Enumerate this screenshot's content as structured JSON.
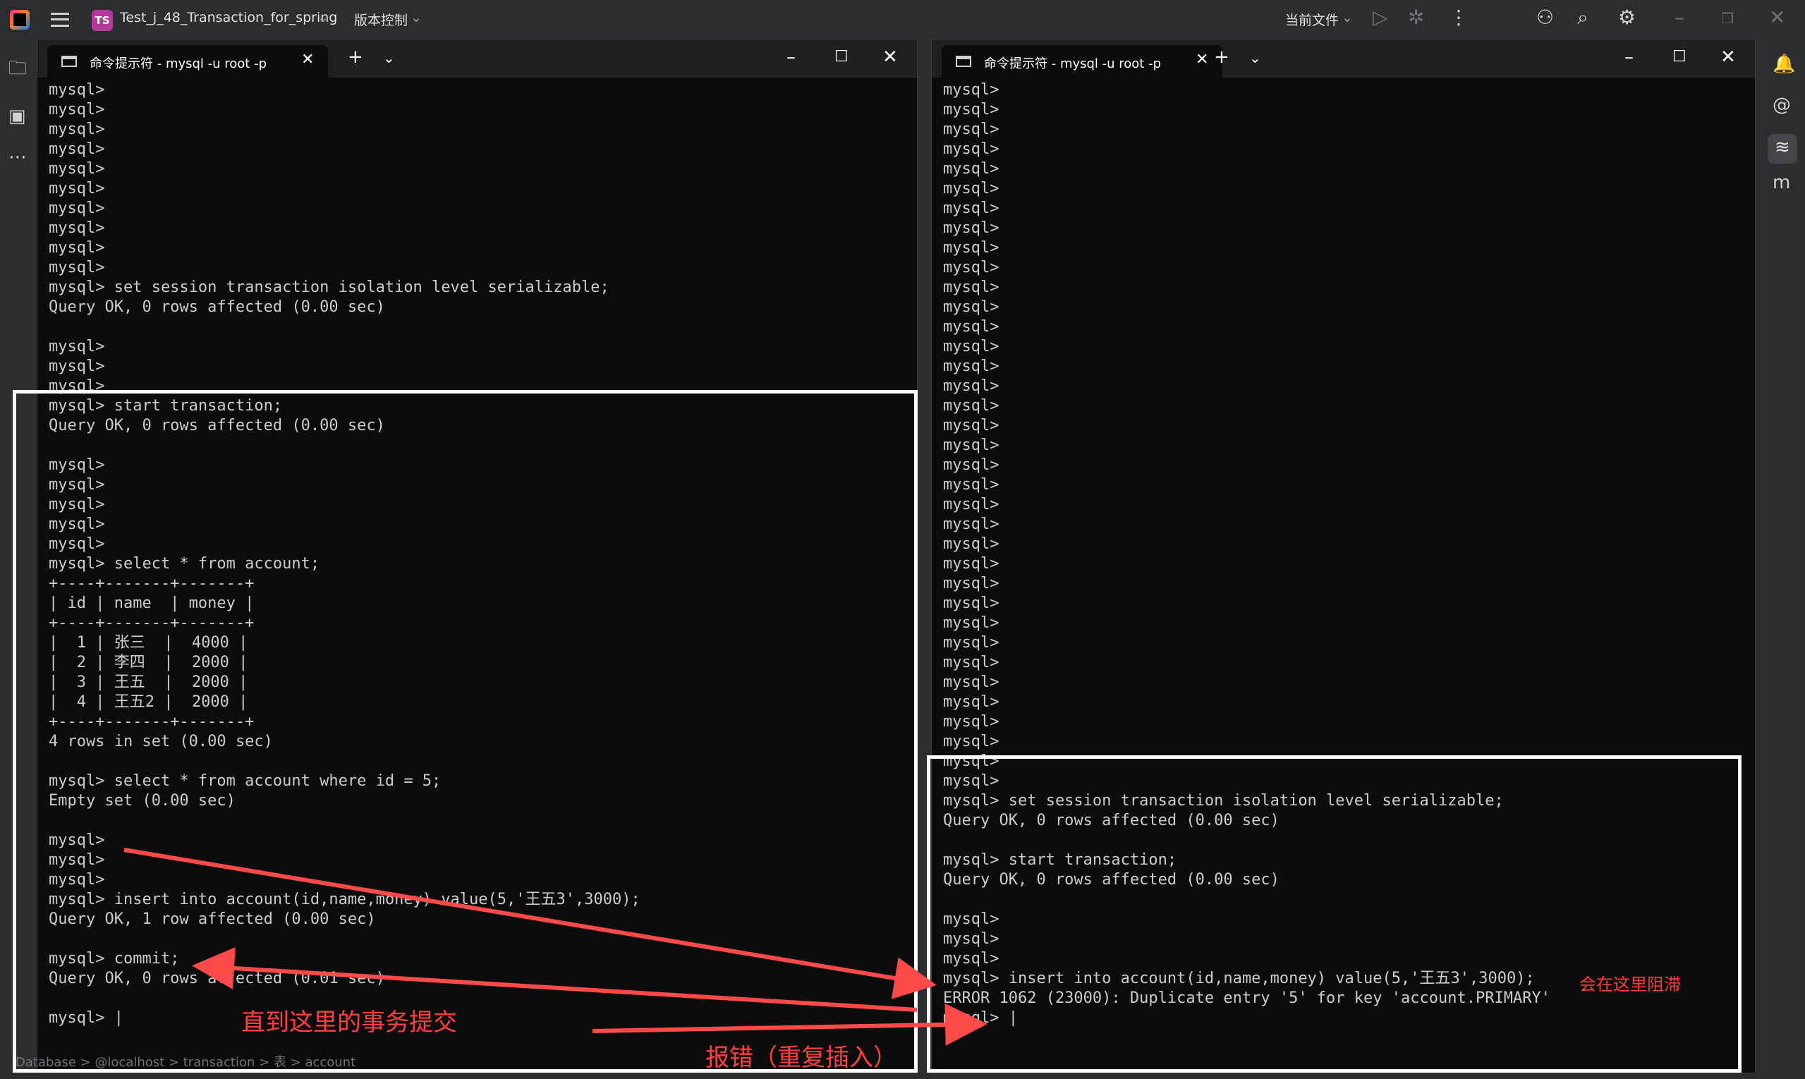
{
  "ide": {
    "project_badge": "TS",
    "project_name": "Test_j_48_Transaction_for_spring",
    "vcs_menu": "版本控制",
    "run_config": "当前文件"
  },
  "terminal_left": {
    "tab_title": "命令提示符 - mysql  -u root -p",
    "lines": [
      "mysql>",
      "mysql>",
      "mysql>",
      "mysql>",
      "mysql>",
      "mysql>",
      "mysql>",
      "mysql>",
      "mysql>",
      "mysql>",
      "mysql> set session transaction isolation level serializable;",
      "Query OK, 0 rows affected (0.00 sec)",
      "",
      "mysql>",
      "mysql>",
      "mysql>",
      "mysql> start transaction;",
      "Query OK, 0 rows affected (0.00 sec)",
      "",
      "mysql>",
      "mysql>",
      "mysql>",
      "mysql>",
      "mysql>",
      "mysql> select * from account;",
      "+----+-------+-------+",
      "| id | name  | money |",
      "+----+-------+-------+",
      "|  1 | 张三  |  4000 |",
      "|  2 | 李四  |  2000 |",
      "|  3 | 王五  |  2000 |",
      "|  4 | 王五2 |  2000 |",
      "+----+-------+-------+",
      "4 rows in set (0.00 sec)",
      "",
      "mysql> select * from account where id = 5;",
      "Empty set (0.00 sec)",
      "",
      "mysql>",
      "mysql>",
      "mysql>",
      "mysql> insert into account(id,name,money) value(5,'王五3',3000);",
      "Query OK, 1 row affected (0.00 sec)",
      "",
      "mysql> commit;",
      "Query OK, 0 rows affected (0.01 sec)",
      "",
      "mysql> |"
    ]
  },
  "terminal_right": {
    "tab_title": "命令提示符 - mysql  -u root -p",
    "lines": [
      "mysql>",
      "mysql>",
      "mysql>",
      "mysql>",
      "mysql>",
      "mysql>",
      "mysql>",
      "mysql>",
      "mysql>",
      "mysql>",
      "mysql>",
      "mysql>",
      "mysql>",
      "mysql>",
      "mysql>",
      "mysql>",
      "mysql>",
      "mysql>",
      "mysql>",
      "mysql>",
      "mysql>",
      "mysql>",
      "mysql>",
      "mysql>",
      "mysql>",
      "mysql>",
      "mysql>",
      "mysql>",
      "mysql>",
      "mysql>",
      "mysql>",
      "mysql>",
      "mysql>",
      "mysql>",
      "mysql>",
      "mysql>",
      "mysql> set session transaction isolation level serializable;",
      "Query OK, 0 rows affected (0.00 sec)",
      "",
      "mysql> start transaction;",
      "Query OK, 0 rows affected (0.00 sec)",
      "",
      "mysql>",
      "mysql>",
      "mysql>",
      "mysql> insert into account(id,name,money) value(5,'王五3',3000); ",
      "ERROR 1062 (23000): Duplicate entry '5' for key 'account.PRIMARY'",
      "mysql> |"
    ],
    "inline_note": "会在这里阻滞"
  },
  "annotations": {
    "commit_note": "直到这里的事务提交",
    "error_note": "报错（重复插入）"
  },
  "breadcrumb": "Database  >  @localhost  >  transaction  >  表  >  account"
}
